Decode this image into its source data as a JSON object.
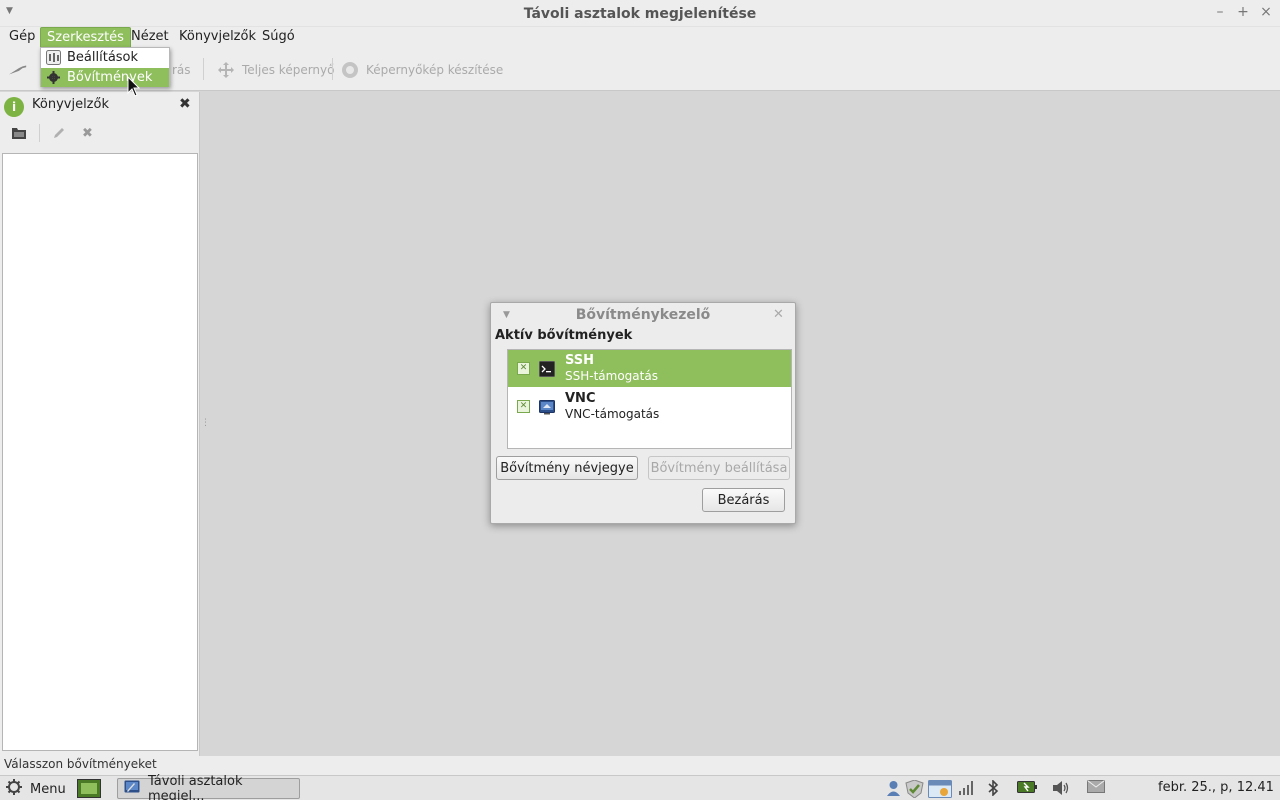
{
  "window": {
    "title": "Távoli asztalok megjelenítése",
    "controls": {
      "minimize": "–",
      "maximize": "+",
      "close": "×"
    }
  },
  "menubar": {
    "items": [
      "Gép",
      "Szerkesztés",
      "Nézet",
      "Könyvjelzők",
      "Súgó"
    ],
    "active": "Szerkesztés"
  },
  "dropdown": {
    "items": [
      {
        "label": "Beállítások",
        "icon": "settings-icon"
      },
      {
        "label": "Bővítmények",
        "icon": "gear-icon",
        "selected": true
      }
    ]
  },
  "toolbar": {
    "hidden_label_tail": "rás",
    "fullscreen_label": "Teljes képernyő",
    "screenshot_label": "Képernyőkép készítése"
  },
  "sidebar": {
    "title": "Könyvjelzők",
    "close": "✖"
  },
  "statusbar": {
    "text": "Válasszon bővítményeket"
  },
  "dialog": {
    "title": "Bővítménykezelő",
    "heading": "Aktív bővítmények",
    "plugins": [
      {
        "name": "SSH",
        "description": "SSH-támogatás",
        "checked": true,
        "selected": true,
        "icon": "terminal-icon"
      },
      {
        "name": "VNC",
        "description": "VNC-támogatás",
        "checked": true,
        "selected": false,
        "icon": "vnc-icon"
      }
    ],
    "about_button": "Bővítmény névjegye",
    "configure_button": "Bővítmény beállítása",
    "close_button": "Bezárás"
  },
  "taskbar": {
    "menu_label": "Menu",
    "window_label": "Távoli asztalok megjel...",
    "clock": "febr. 25., p, 12.41"
  },
  "colors": {
    "accent": "#8fbe5c",
    "background": "#d6d6d6",
    "panel": "#ededed"
  }
}
